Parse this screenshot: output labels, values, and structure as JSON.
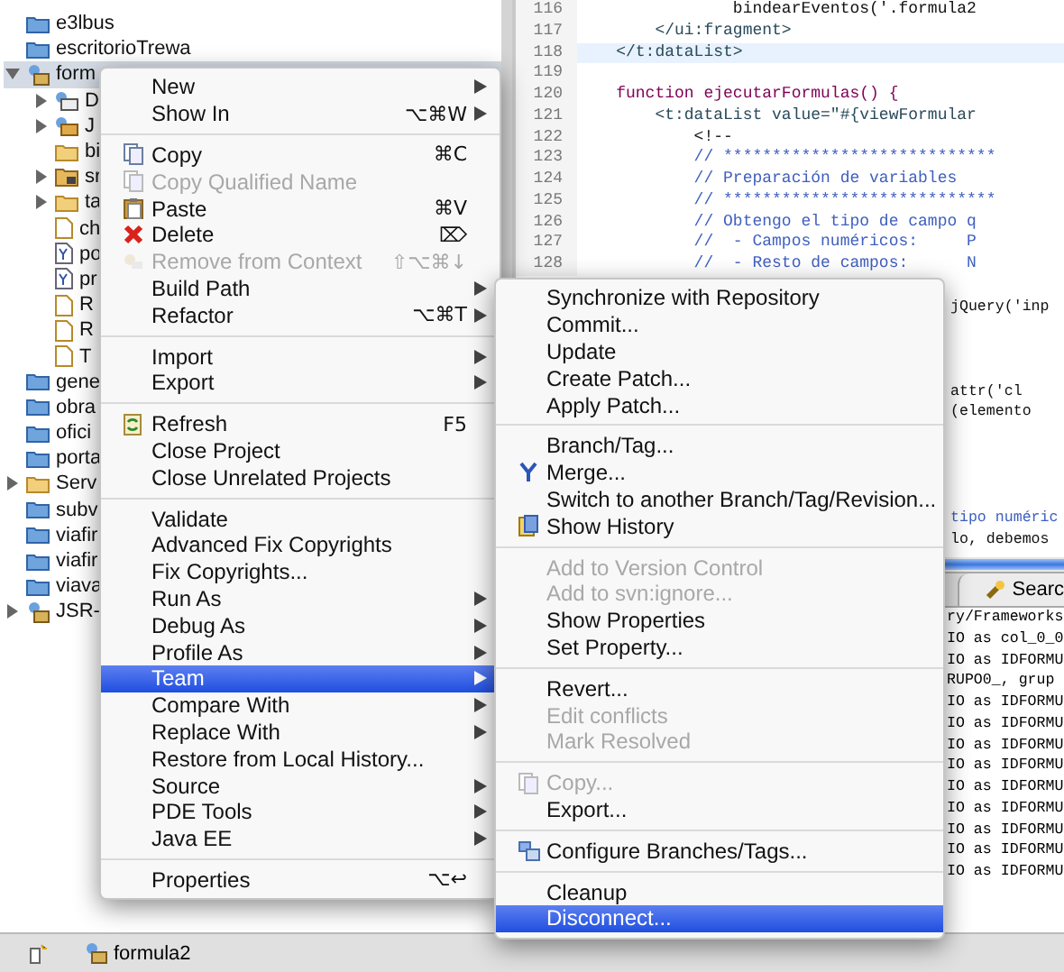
{
  "project_tree": [
    {
      "label": "e3lbus",
      "kind": "project"
    },
    {
      "label": "escritorioTrewa",
      "kind": "project"
    },
    {
      "label": "form",
      "kind": "java_project",
      "expanded": true,
      "selected": true,
      "children": [
        {
          "label": "D",
          "kind": "descriptor",
          "expanded": false
        },
        {
          "label": "J",
          "kind": "library",
          "expanded": false
        },
        {
          "label": "bi",
          "kind": "folder"
        },
        {
          "label": "sr",
          "kind": "source",
          "expanded": false
        },
        {
          "label": "ta",
          "kind": "folder",
          "expanded": false
        },
        {
          "label": "ch",
          "kind": "file"
        },
        {
          "label": "po",
          "kind": "xml"
        },
        {
          "label": "pr",
          "kind": "xml"
        },
        {
          "label": "R",
          "kind": "file"
        },
        {
          "label": "R",
          "kind": "file"
        },
        {
          "label": "T",
          "kind": "file"
        }
      ]
    },
    {
      "label": "gene",
      "kind": "project"
    },
    {
      "label": "obra",
      "kind": "project"
    },
    {
      "label": "ofici",
      "kind": "project"
    },
    {
      "label": "porta",
      "kind": "project"
    },
    {
      "label": "Serv",
      "kind": "folder",
      "expanded": false
    },
    {
      "label": "subv",
      "kind": "project"
    },
    {
      "label": "viafir",
      "kind": "project"
    },
    {
      "label": "viafir",
      "kind": "project"
    },
    {
      "label": "viava",
      "kind": "project"
    },
    {
      "label": "JSR-",
      "kind": "java_project",
      "expanded": false
    }
  ],
  "editor": {
    "lines": [
      {
        "number": "116",
        "text": "                bindearEventos('.formula2",
        "kind": "plain",
        "current": false
      },
      {
        "number": "117",
        "text": "        </ui:fragment>",
        "kind": "tag",
        "current": false
      },
      {
        "number": "118",
        "text": "    </t:dataList>",
        "kind": "tag",
        "current": true
      },
      {
        "number": "119",
        "kind": "plain",
        "current": false
      },
      {
        "number": "120",
        "text": "    function ejecutarFormulas() {",
        "kind": "function",
        "current": false
      },
      {
        "number": "121",
        "text": "        <t:dataList value=\"#{viewFormular",
        "kind": "tag",
        "current": false
      },
      {
        "number": "122",
        "text": "            <!--",
        "kind": "plain",
        "current": false
      },
      {
        "number": "123",
        "text": "            // ****************************",
        "kind": "comment",
        "current": false
      },
      {
        "number": "124",
        "text": "            // Preparación de variables",
        "kind": "comment",
        "current": false
      },
      {
        "number": "125",
        "text": "            // ****************************",
        "kind": "comment",
        "current": false
      },
      {
        "number": "126",
        "text": "            // Obtengo el tipo de campo q",
        "kind": "comment",
        "current": false
      },
      {
        "number": "127",
        "text": "            //  - Campos numéricos:     P",
        "kind": "comment",
        "current": false
      },
      {
        "number": "128",
        "text": "            //  - Resto de campos:      N",
        "kind": "comment",
        "current": false
      }
    ],
    "hidden_fragments": [
      {
        "text": "jQuery('inp",
        "kind": "plain"
      },
      {
        "text": "attr('cl",
        "kind": "plain"
      },
      {
        "text": "(elemento",
        "kind": "plain"
      },
      {
        "text": "tipo numéric",
        "kind": "comment"
      },
      {
        "text": "lo, debemos",
        "kind": "plain"
      }
    ]
  },
  "console": {
    "tabs": [
      {
        "label": "Searc"
      }
    ],
    "path": "ry/Frameworks",
    "lines": [
      "IO as col_0_0",
      "IO as IDFORMU",
      "RUPO0_, grup",
      "IO as IDFORMU",
      "IO as IDFORMU",
      "IO as IDFORMU",
      "IO as IDFORMU",
      "IO as IDFORMU",
      "IO as IDFORMU",
      "IO as IDFORMU",
      "IO as IDFORMU",
      "IO as IDFORMU"
    ]
  },
  "context_menu": {
    "groups": [
      [
        {
          "label": "New",
          "kind": "plain",
          "submenu": true,
          "disabled": false,
          "selected": false
        },
        {
          "label": "Show In",
          "kind": "plain",
          "shortcut": "⌥⌘W",
          "submenu": true,
          "disabled": false,
          "selected": false
        }
      ],
      [
        {
          "label": "Copy",
          "kind": "copy",
          "shortcut": "⌘C",
          "disabled": false,
          "selected": false
        },
        {
          "label": "Copy Qualified Name",
          "kind": "copy",
          "disabled": true,
          "selected": false
        },
        {
          "label": "Paste",
          "kind": "paste",
          "shortcut": "⌘V",
          "disabled": false,
          "selected": false
        },
        {
          "label": "Delete",
          "kind": "delete",
          "shortcut": "⌦",
          "disabled": false,
          "selected": false
        },
        {
          "label": "Remove from Context",
          "kind": "context",
          "shortcut": "⇧⌥⌘↓",
          "disabled": true,
          "selected": false
        },
        {
          "label": "Build Path",
          "kind": "plain",
          "submenu": true,
          "disabled": false,
          "selected": false
        },
        {
          "label": "Refactor",
          "kind": "plain",
          "shortcut": "⌥⌘T",
          "submenu": true,
          "disabled": false,
          "selected": false
        }
      ],
      [
        {
          "label": "Import",
          "kind": "plain",
          "submenu": true,
          "disabled": false,
          "selected": false
        },
        {
          "label": "Export",
          "kind": "plain",
          "submenu": true,
          "disabled": false,
          "selected": false
        }
      ],
      [
        {
          "label": "Refresh",
          "kind": "refresh",
          "shortcut": "F5",
          "disabled": false,
          "selected": false
        },
        {
          "label": "Close Project",
          "kind": "plain",
          "disabled": false,
          "selected": false
        },
        {
          "label": "Close Unrelated Projects",
          "kind": "plain",
          "disabled": false,
          "selected": false
        }
      ],
      [
        {
          "label": "Validate",
          "kind": "plain",
          "disabled": false,
          "selected": false
        },
        {
          "label": "Advanced Fix Copyrights",
          "kind": "plain",
          "disabled": false,
          "selected": false
        },
        {
          "label": "Fix Copyrights...",
          "kind": "plain",
          "disabled": false,
          "selected": false
        },
        {
          "label": "Run As",
          "kind": "plain",
          "submenu": true,
          "disabled": false,
          "selected": false
        },
        {
          "label": "Debug As",
          "kind": "plain",
          "submenu": true,
          "disabled": false,
          "selected": false
        },
        {
          "label": "Profile As",
          "kind": "plain",
          "submenu": true,
          "disabled": false,
          "selected": false
        },
        {
          "label": "Team",
          "kind": "plain",
          "submenu": true,
          "disabled": false,
          "selected": true
        },
        {
          "label": "Compare With",
          "kind": "plain",
          "submenu": true,
          "disabled": false,
          "selected": false
        },
        {
          "label": "Replace With",
          "kind": "plain",
          "submenu": true,
          "disabled": false,
          "selected": false
        },
        {
          "label": "Restore from Local History...",
          "kind": "plain",
          "disabled": false,
          "selected": false
        },
        {
          "label": "Source",
          "kind": "plain",
          "submenu": true,
          "disabled": false,
          "selected": false
        },
        {
          "label": "PDE Tools",
          "kind": "plain",
          "submenu": true,
          "disabled": false,
          "selected": false
        },
        {
          "label": "Java EE",
          "kind": "plain",
          "submenu": true,
          "disabled": false,
          "selected": false
        }
      ],
      [
        {
          "label": "Properties",
          "kind": "plain",
          "shortcut": "⌥↩",
          "disabled": false,
          "selected": false
        }
      ]
    ]
  },
  "team_submenu": {
    "groups": [
      [
        {
          "label": "Synchronize with Repository",
          "kind": "plain",
          "disabled": false,
          "selected": false
        },
        {
          "label": "Commit...",
          "kind": "plain",
          "disabled": false,
          "selected": false
        },
        {
          "label": "Update",
          "kind": "plain",
          "disabled": false,
          "selected": false
        },
        {
          "label": "Create Patch...",
          "kind": "plain",
          "disabled": false,
          "selected": false
        },
        {
          "label": "Apply Patch...",
          "kind": "plain",
          "disabled": false,
          "selected": false
        }
      ],
      [
        {
          "label": "Branch/Tag...",
          "kind": "plain",
          "disabled": false,
          "selected": false
        },
        {
          "label": "Merge...",
          "kind": "merge",
          "disabled": false,
          "selected": false
        },
        {
          "label": "Switch to another Branch/Tag/Revision...",
          "kind": "plain",
          "disabled": false,
          "selected": false
        },
        {
          "label": "Show History",
          "kind": "history",
          "disabled": false,
          "selected": false
        }
      ],
      [
        {
          "label": "Add to Version Control",
          "kind": "plain",
          "disabled": true,
          "selected": false
        },
        {
          "label": "Add to svn:ignore...",
          "kind": "plain",
          "disabled": true,
          "selected": false
        },
        {
          "label": "Show Properties",
          "kind": "plain",
          "disabled": false,
          "selected": false
        },
        {
          "label": "Set Property...",
          "kind": "plain",
          "disabled": false,
          "selected": false
        }
      ],
      [
        {
          "label": "Revert...",
          "kind": "plain",
          "disabled": false,
          "selected": false
        },
        {
          "label": "Edit conflicts",
          "kind": "plain",
          "disabled": true,
          "selected": false
        },
        {
          "label": "Mark Resolved",
          "kind": "plain",
          "disabled": true,
          "selected": false
        }
      ],
      [
        {
          "label": "Copy...",
          "kind": "copy",
          "disabled": true,
          "selected": false
        },
        {
          "label": "Export...",
          "kind": "plain",
          "disabled": false,
          "selected": false
        }
      ],
      [
        {
          "label": "Configure Branches/Tags...",
          "kind": "branches",
          "disabled": false,
          "selected": false
        }
      ],
      [
        {
          "label": "Cleanup",
          "kind": "plain",
          "disabled": false,
          "selected": false
        },
        {
          "label": "Disconnect...",
          "kind": "plain",
          "disabled": false,
          "selected": true
        }
      ]
    ]
  },
  "status_bar": {
    "label": "formula2"
  }
}
